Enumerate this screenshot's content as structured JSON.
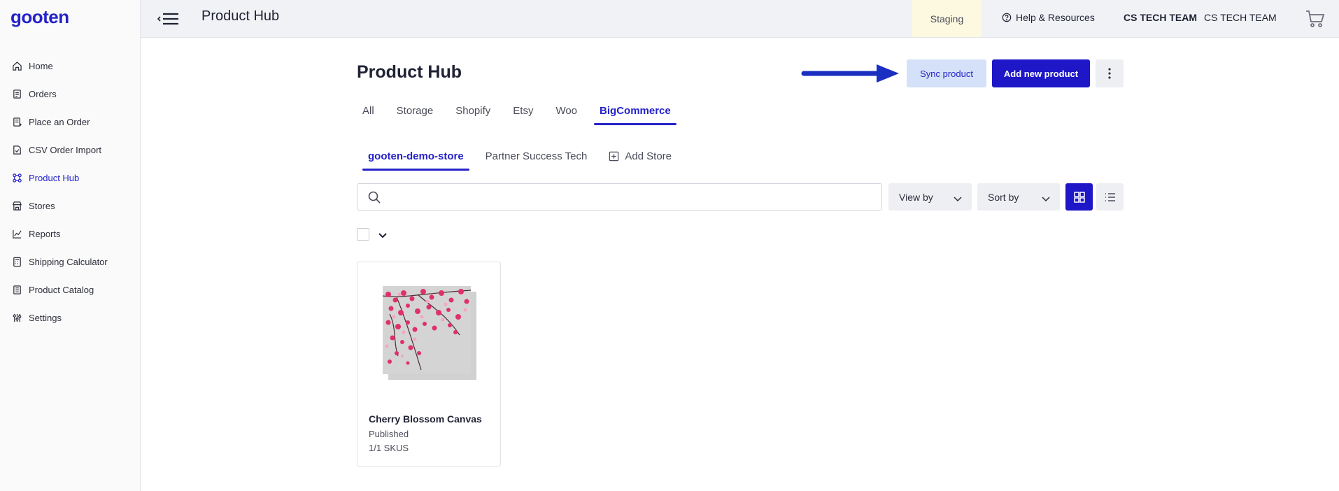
{
  "app": {
    "logo": "gooten"
  },
  "topbar": {
    "title": "Product Hub",
    "environment": "Staging",
    "help": "Help & Resources",
    "team_bold": "CS TECH TEAM",
    "team": "CS TECH TEAM"
  },
  "sidebar": {
    "items": [
      {
        "label": "Home",
        "icon": "home-icon"
      },
      {
        "label": "Orders",
        "icon": "orders-icon"
      },
      {
        "label": "Place an Order",
        "icon": "place-order-icon"
      },
      {
        "label": "CSV Order Import",
        "icon": "csv-import-icon"
      },
      {
        "label": "Product Hub",
        "icon": "product-hub-icon",
        "active": true
      },
      {
        "label": "Stores",
        "icon": "store-icon"
      },
      {
        "label": "Reports",
        "icon": "reports-icon"
      },
      {
        "label": "Shipping Calculator",
        "icon": "calculator-icon"
      },
      {
        "label": "Product Catalog",
        "icon": "catalog-icon"
      },
      {
        "label": "Settings",
        "icon": "settings-icon"
      }
    ]
  },
  "main": {
    "title": "Product Hub",
    "sync_label": "Sync product",
    "add_label": "Add new product",
    "tabs": [
      "All",
      "Storage",
      "Shopify",
      "Etsy",
      "Woo",
      "BigCommerce"
    ],
    "active_tab": "BigCommerce",
    "stores": [
      "gooten-demo-store",
      "Partner Success Tech"
    ],
    "add_store": "Add Store",
    "search": {
      "value": "",
      "placeholder": ""
    },
    "view_by": "View by",
    "sort_by": "Sort by",
    "products": [
      {
        "name": "Cherry Blossom Canvas",
        "status": "Published",
        "skus": "1/1 SKUS"
      }
    ]
  },
  "colors": {
    "accent": "#1e17c8",
    "sync_bg": "#d4e1f8",
    "staging_bg": "#fdf9e1"
  }
}
